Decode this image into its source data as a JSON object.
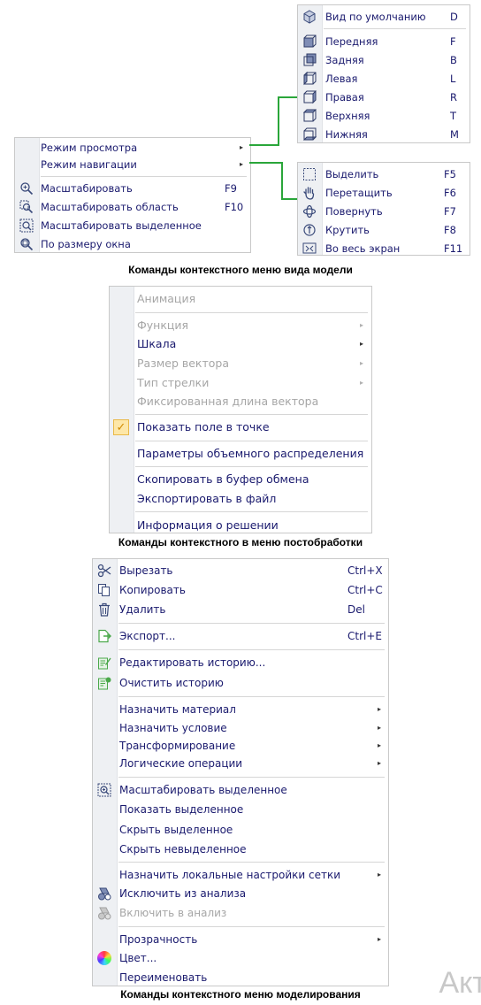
{
  "view_menu": {
    "items": [
      {
        "label": "Режим просмотра"
      },
      {
        "label": "Режим навигации"
      },
      {
        "label": "Масштабировать",
        "key": "F9"
      },
      {
        "label": "Масштабировать область",
        "key": "F10"
      },
      {
        "label": "Масштабировать выделенное"
      },
      {
        "label": "По размеру окна"
      }
    ]
  },
  "view_mode_submenu": {
    "items": [
      {
        "label": "Вид по умолчанию",
        "key": "D"
      },
      {
        "label": "Передняя",
        "key": "F"
      },
      {
        "label": "Задняя",
        "key": "B"
      },
      {
        "label": "Левая",
        "key": "L"
      },
      {
        "label": "Правая",
        "key": "R"
      },
      {
        "label": "Верхняя",
        "key": "T"
      },
      {
        "label": "Нижняя",
        "key": "M"
      }
    ]
  },
  "nav_mode_submenu": {
    "items": [
      {
        "label": "Выделить",
        "key": "F5"
      },
      {
        "label": "Перетащить",
        "key": "F6"
      },
      {
        "label": "Повернуть",
        "key": "F7"
      },
      {
        "label": "Крутить",
        "key": "F8"
      },
      {
        "label": "Во весь экран",
        "key": "F11"
      }
    ]
  },
  "caption1": "Команды контекстного меню вида модели",
  "post_menu": {
    "items": [
      {
        "label": "Анимация"
      },
      {
        "label": "Функция"
      },
      {
        "label": "Шкала"
      },
      {
        "label": "Размер вектора"
      },
      {
        "label": "Тип стрелки"
      },
      {
        "label": "Фиксированная длина вектора"
      },
      {
        "label": "Показать поле в точке"
      },
      {
        "label": "Параметры объемного распределения"
      },
      {
        "label": "Скопировать в буфер обмена"
      },
      {
        "label": "Экспортировать в файл"
      },
      {
        "label": "Информация о решении"
      }
    ],
    "check": "✓"
  },
  "caption2": "Команды контекстного в меню постобработки",
  "model_menu": {
    "items": [
      {
        "label": "Вырезать",
        "key": "Ctrl+X"
      },
      {
        "label": "Копировать",
        "key": "Ctrl+C"
      },
      {
        "label": "Удалить",
        "key": "Del"
      },
      {
        "label": "Экспорт...",
        "key": "Ctrl+E"
      },
      {
        "label": "Редактировать историю..."
      },
      {
        "label": "Очистить историю"
      },
      {
        "label": "Назначить материал"
      },
      {
        "label": "Назначить условие"
      },
      {
        "label": "Трансформирование"
      },
      {
        "label": "Логические операции"
      },
      {
        "label": "Масштабировать выделенное"
      },
      {
        "label": "Показать выделенное"
      },
      {
        "label": "Скрыть выделенное"
      },
      {
        "label": "Скрыть невыделенное"
      },
      {
        "label": "Назначить локальные настройки сетки"
      },
      {
        "label": "Исключить из анализа"
      },
      {
        "label": "Включить в анализ"
      },
      {
        "label": "Прозрачность"
      },
      {
        "label": "Цвет..."
      },
      {
        "label": "Переименовать"
      }
    ]
  },
  "caption3": "Команды контекстного меню моделирования",
  "watermark": "Акт",
  "colors": {
    "accent_line": "#2aa63a",
    "text": "#1a1a6e",
    "disabled": "#a6a6a6"
  }
}
